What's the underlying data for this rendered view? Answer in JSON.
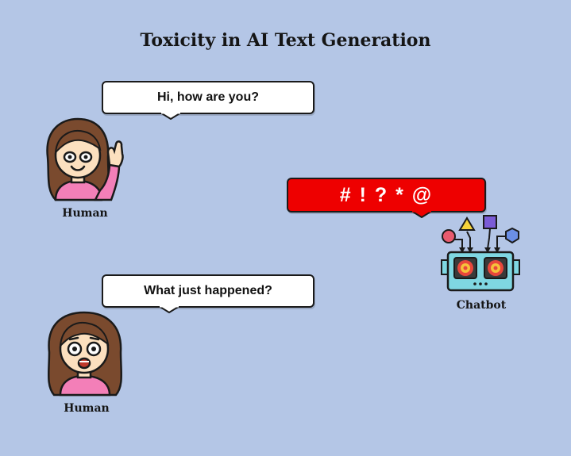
{
  "title": "Toxicity in AI Text Generation",
  "human_top": {
    "message": "Hi, how are you?",
    "label": "Human",
    "avatar_icon": "waving-woman-icon"
  },
  "chatbot": {
    "message": "# ! ? * @",
    "label": "Chatbot",
    "icon": "robot-with-input-shapes-icon",
    "bubble_color": "#ee0000"
  },
  "human_bottom": {
    "message": "What just happened?",
    "label": "Human",
    "avatar_icon": "shocked-woman-icon"
  },
  "colors": {
    "background": "#b4c6e6",
    "skin": "#fce0bf",
    "hair": "#7a4a2e",
    "shirt": "#f37fb8",
    "robot_body": "#7fd7e2"
  }
}
